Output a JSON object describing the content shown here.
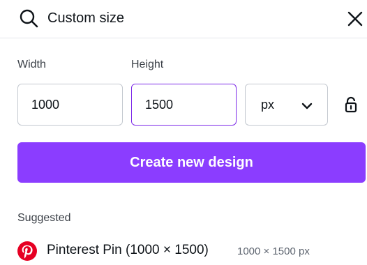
{
  "search": {
    "value": "Custom size"
  },
  "fields": {
    "width_label": "Width",
    "height_label": "Height",
    "width_value": "1000",
    "height_value": "1500",
    "unit": "px"
  },
  "actions": {
    "create_label": "Create new design"
  },
  "suggested": {
    "heading": "Suggested",
    "items": [
      {
        "name": "Pinterest Pin (1000 × 1500)",
        "dimensions": "1000 × 1500 px",
        "icon": "pinterest-icon"
      }
    ]
  },
  "colors": {
    "accent": "#8b3dff",
    "focus_border": "#7d2ae8",
    "pinterest": "#e60023"
  }
}
